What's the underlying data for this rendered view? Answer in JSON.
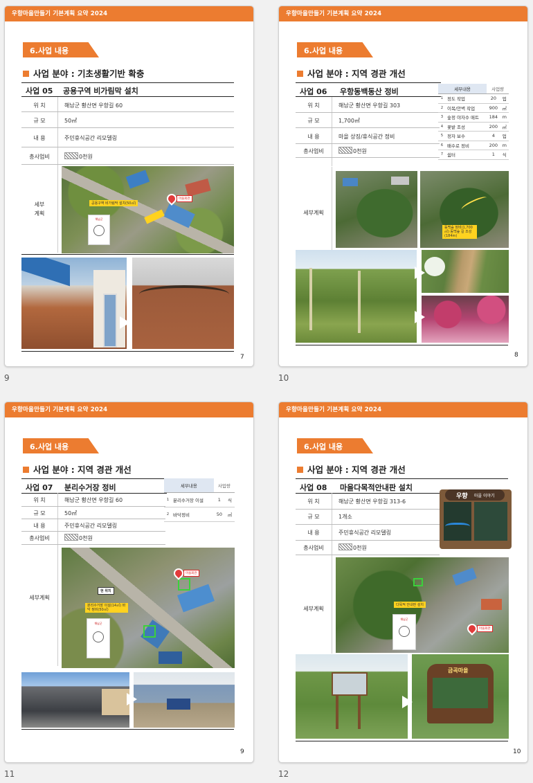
{
  "header_text": "우향마을만들기 기본계획 요약 2024",
  "section_label": "6.사업 내용",
  "row_labels": {
    "location": "위 치",
    "scale": "규 모",
    "content": "내 용",
    "cost": "총사업비",
    "plan": "세부계획",
    "plan_split": [
      "세부",
      "계획"
    ]
  },
  "arrow_glyph": ">",
  "slides": [
    {
      "caption": "9",
      "page_number": "7",
      "field": "사업 분야 : 기초생활기반 확충",
      "project_no": "사업 05",
      "project_name": "공용구역 비가림막 설치",
      "location": "해남군 황산면 우항길 60",
      "scale": "50㎡",
      "content": "주민휴식공간 리모델링",
      "cost": "0천원",
      "map_tag": "공용구역 비가림막 설치(50㎡)",
      "pin_label": "마을회관",
      "legend_text": "해남군"
    },
    {
      "caption": "10",
      "page_number": "8",
      "field": "사업 분야 : 지역 경관 개선",
      "project_no": "사업 06",
      "project_name": "우항동백동산 정비",
      "location": "해남군 황산면 우항길 303",
      "scale": "1,700㎡",
      "content": "마을 상징/휴식공간 정비",
      "cost": "0천원",
      "table_headers": [
        "세부내용",
        "사업량"
      ],
      "table_rows": [
        {
          "no": "1",
          "item": "정도 작업",
          "qty": "20",
          "unit": "업"
        },
        {
          "no": "2",
          "item": "이목/안벽 작업",
          "qty": "900",
          "unit": "㎡"
        },
        {
          "no": "3",
          "item": "숲정 야자수 매트",
          "qty": "184",
          "unit": "m"
        },
        {
          "no": "4",
          "item": "꽃밭 조성",
          "qty": "200",
          "unit": "㎡"
        },
        {
          "no": "5",
          "item": "정자 보수",
          "qty": "4",
          "unit": "업"
        },
        {
          "no": "6",
          "item": "배수로 정비",
          "qty": "200",
          "unit": "m"
        },
        {
          "no": "7",
          "item": "쉼터",
          "qty": "1",
          "unit": "식"
        }
      ],
      "map_tag": "동백숲 정비(1,700㎡) 동백숲 길 조성(184m)"
    },
    {
      "caption": "11",
      "page_number": "9",
      "field": "사업 분야 : 지역 경관 개선",
      "project_no": "사업 07",
      "project_name": "분리수거장 정비",
      "location": "해남군 황산면 우항길 60",
      "scale": "50㎡",
      "content": "주민휴식공간 리모델링",
      "cost": "0천원",
      "table_headers": [
        "세부내용",
        "사업량"
      ],
      "table_rows": [
        {
          "no": "1",
          "item": "분리수거장 이설",
          "qty": "1",
          "unit": "식"
        },
        {
          "no": "2",
          "item": "바닥정비",
          "qty": "50",
          "unit": "㎡"
        }
      ],
      "map_tag_1": "현 위치",
      "map_tag_2": "분리수거장 이설(14㎡) 바닥 정비(50㎡)",
      "pin_label": "마을회관",
      "legend_text": "해남군"
    },
    {
      "caption": "12",
      "page_number": "10",
      "field": "사업 분야 : 지역 경관 개선",
      "project_no": "사업 08",
      "project_name": "마을다목적안내판 설치",
      "location": "해남군 황산면 우항길 313-6",
      "scale": "1개소",
      "content": "주민휴식공간 리모델링",
      "cost": "0천원",
      "board_title": "우향",
      "board_subtitle": "마을 이야기",
      "map_tag": "다목적 안내판 설치",
      "pin_label": "마을회관",
      "sign_title": "금곡마을",
      "legend_text": "해남군"
    }
  ]
}
